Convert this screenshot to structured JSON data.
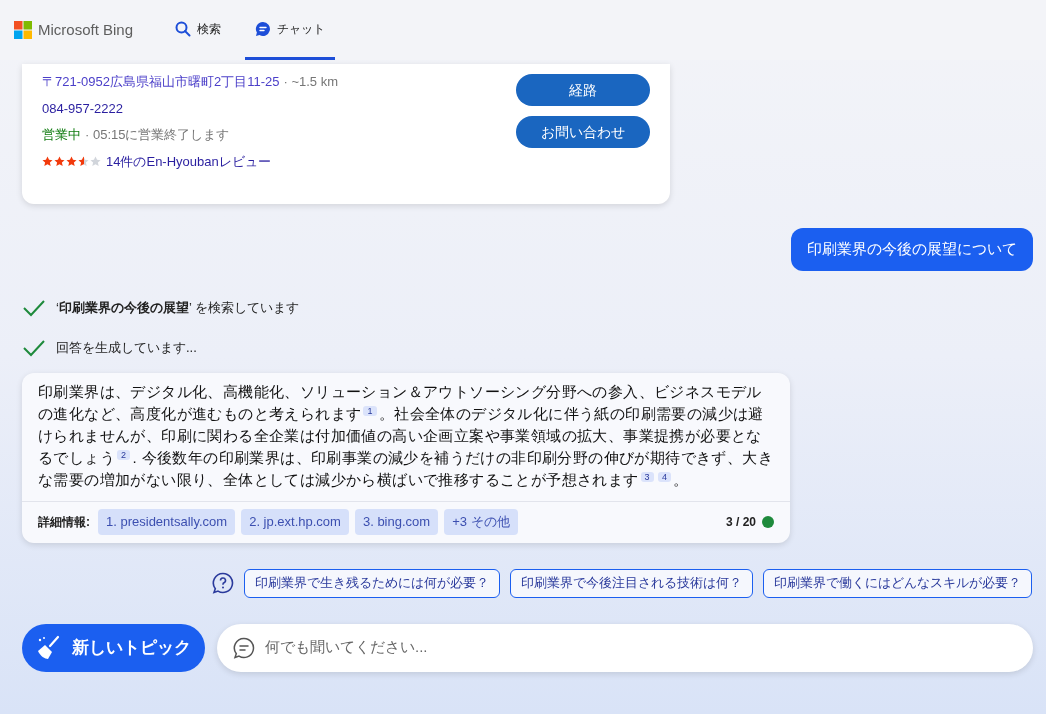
{
  "header": {
    "logo": "Microsoft Bing",
    "tabs": [
      {
        "label": "検索",
        "kind": "search",
        "selected": false
      },
      {
        "label": "チャット",
        "kind": "chat",
        "selected": true
      }
    ]
  },
  "place_card": {
    "address": "〒721-0952広島県福山市曙町2丁目11-25",
    "distance": "· ~1.5 km",
    "phone": "084-957-2222",
    "status": "営業中",
    "hours": "· 05:15に営業終了します",
    "stars": 3.5,
    "reviews": "14件のEn-Hyoubanレビュー",
    "buttons": [
      "経路",
      "お問い合わせ"
    ]
  },
  "user_message": "印刷業界の今後の展望について",
  "progress": [
    {
      "text": "‘**印刷業界の今後の展望**’ を検索しています",
      "done": true
    },
    {
      "text": "回答を生成しています...",
      "done": true
    }
  ],
  "answer": {
    "segments": [
      {
        "kind": "text",
        "text": "印刷業界は、デジタル化、高機能化、ソリューション＆アウトソーシング分野への参入、ビジネスモデルの進化など、高度化が進むものと考えられます"
      },
      {
        "kind": "cite",
        "text": "1"
      },
      {
        "kind": "text",
        "text": "。社会全体のデジタル化に伴う紙の印刷需要の減少は避けられませんが、印刷に関わる全企業は付加価値の高い企画立案や事業領域の拡大、事業提携が必要となるでしょう"
      },
      {
        "kind": "cite",
        "text": "2"
      },
      {
        "kind": "text",
        "text": ". 今後数年の印刷業界は、印刷事業の減少を補うだけの非印刷分野の伸びが期待できず、大きな需要の増加がない限り、全体としては減少から横ばいで推移することが予想されます"
      },
      {
        "kind": "cite",
        "text": "3"
      },
      {
        "kind": "cite",
        "text": "4"
      },
      {
        "kind": "text",
        "text": "。"
      }
    ],
    "sources_label": "詳細情報:",
    "sources": [
      "1. presidentsally.com",
      "2. jp.ext.hp.com",
      "3. bing.com",
      "+3 その他"
    ],
    "count": "3 / 20"
  },
  "suggestions": [
    "印刷業界で生き残るためには何が必要？",
    "印刷業界で今後注目される技術は何？",
    "印刷業界で働くにはどんなスキルが必要？"
  ],
  "new_topic": "新しいトピック",
  "input": {
    "placeholder": "何でも聞いてください..."
  }
}
